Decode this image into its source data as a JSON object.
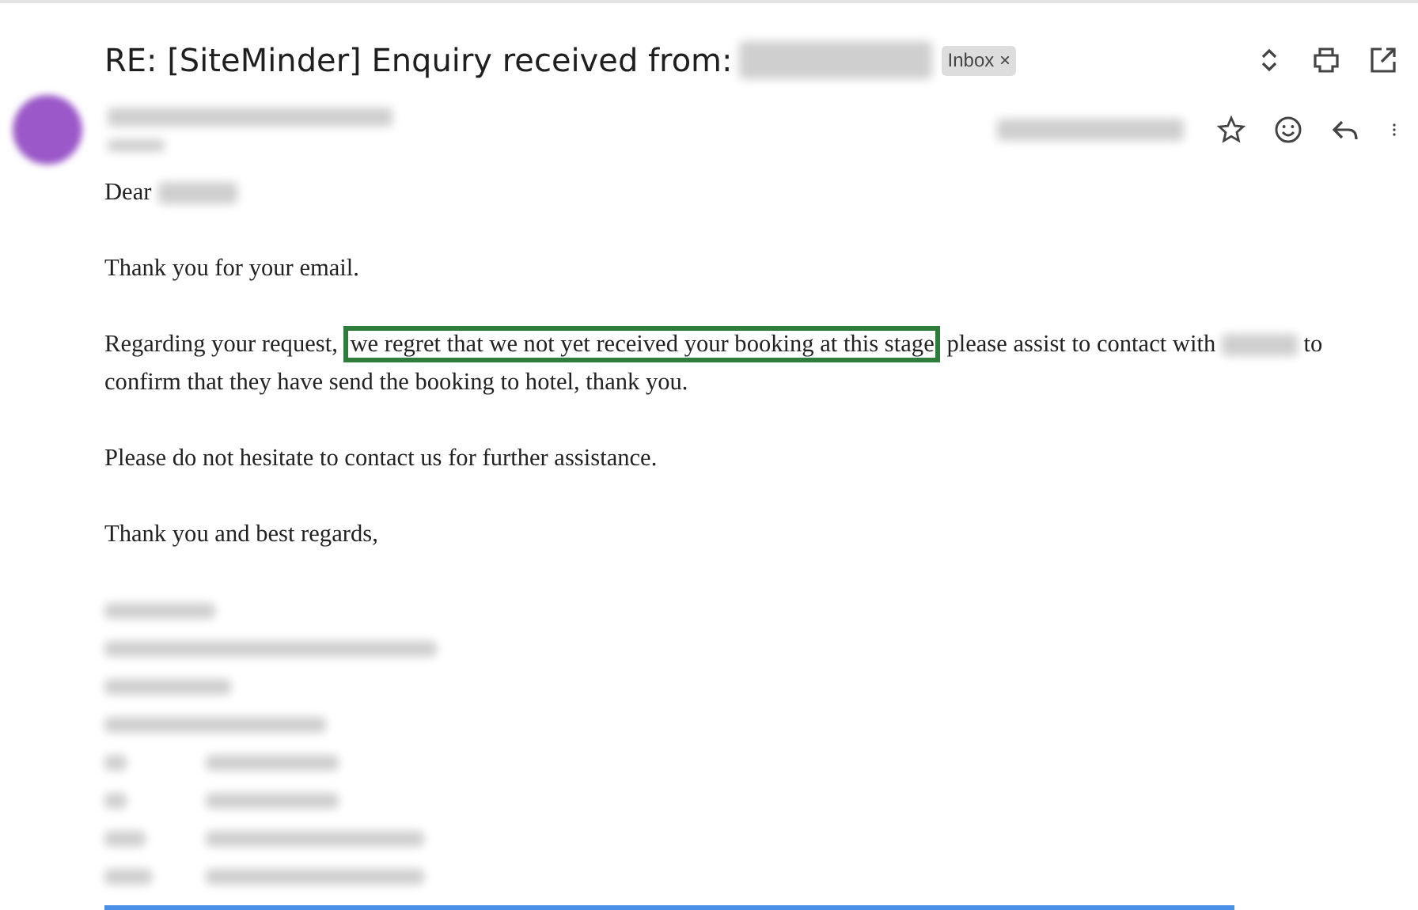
{
  "subject": {
    "text": "RE: [SiteMinder] Enquiry received from:",
    "label": {
      "text": "Inbox",
      "remove": "×"
    }
  },
  "message": {
    "greeting": "Dear",
    "paragraphs": [
      {
        "parts": [
          {
            "kind": "text",
            "text": "Thank you for your email."
          }
        ]
      },
      {
        "parts": [
          {
            "kind": "text",
            "text": "Regarding your request,"
          },
          {
            "kind": "text",
            "text": "we regret that we not yet received your booking at this stage",
            "highlighted": true
          },
          {
            "kind": "text",
            "text": "please assist to contact with"
          },
          {
            "kind": "redacted"
          },
          {
            "kind": "text",
            "text": "to"
          },
          {
            "kind": "text",
            "text": "confirm that they have send the booking to hotel, thank you."
          }
        ]
      },
      {
        "parts": [
          {
            "kind": "text",
            "text": "Please do not hesitate to contact us for further assistance."
          }
        ]
      },
      {
        "parts": [
          {
            "kind": "text",
            "text": "Thank you and best regards,"
          }
        ]
      }
    ]
  }
}
